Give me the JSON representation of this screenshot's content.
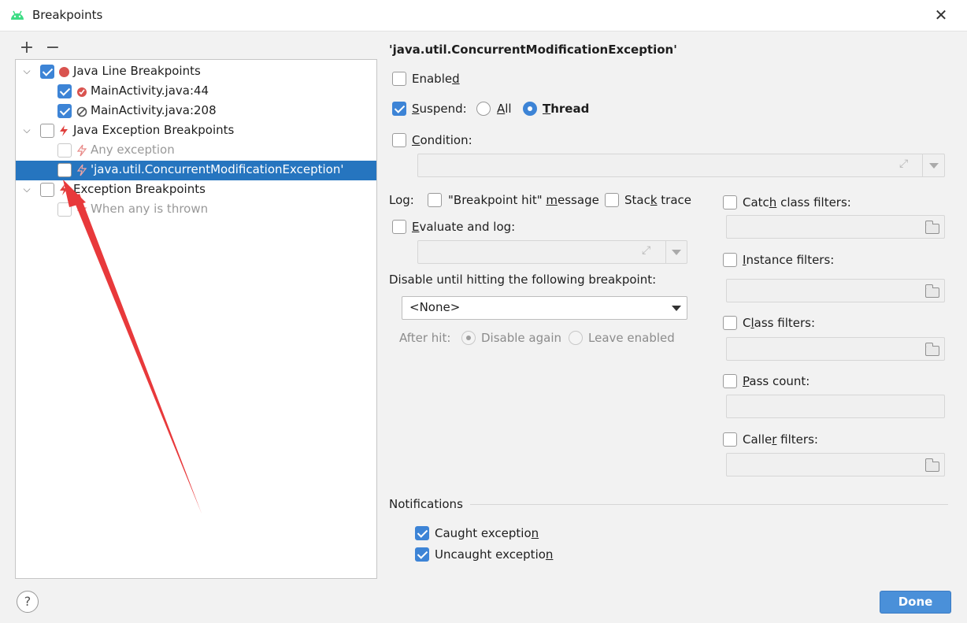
{
  "window": {
    "title": "Breakpoints",
    "close_glyph": "✕",
    "accent": "#3d84d6",
    "selection": "#2675bf",
    "annotation_arrow": "#e8393b"
  },
  "toolbar": {
    "add_glyph": "+",
    "remove_glyph": "−"
  },
  "tree": {
    "java_line": {
      "label": "Java Line Breakpoints",
      "checked": true
    },
    "line_bp_1": {
      "label": "MainActivity.java:44",
      "checked": true
    },
    "line_bp_2": {
      "label": "MainActivity.java:208",
      "checked": true
    },
    "java_exc": {
      "label": "Java Exception Breakpoints",
      "checked": false
    },
    "any_exc": {
      "label": "Any exception",
      "checked": false
    },
    "cme": {
      "label": "'java.util.ConcurrentModificationException'",
      "checked": false,
      "selected": true
    },
    "exc_bp": {
      "label": "Exception Breakpoints",
      "checked": false
    },
    "any_thrown": {
      "label": "When any is thrown",
      "checked": false
    }
  },
  "details": {
    "header": "'java.util.ConcurrentModificationException'",
    "enabled": {
      "pre": "Enable",
      "ul": "d",
      "post": "",
      "checked": false
    },
    "suspend": {
      "pre": "",
      "ul": "S",
      "post": "uspend:",
      "checked": true
    },
    "suspend_all": {
      "pre": "",
      "ul": "A",
      "post": "ll"
    },
    "suspend_thread": {
      "pre": "",
      "ul": "T",
      "post": "hread"
    },
    "condition": {
      "pre": "",
      "ul": "C",
      "post": "ondition:"
    },
    "log_label": "Log:",
    "bp_hit_msg": {
      "pre": "\"Breakpoint hit\" ",
      "ul": "m",
      "post": "essage"
    },
    "stack_trace": {
      "pre": "Stac",
      "ul": "k",
      "post": " trace"
    },
    "evaluate_log": {
      "pre": "",
      "ul": "E",
      "post": "valuate and log:"
    },
    "disable_until_label": "Disable until hitting the following breakpoint:",
    "disable_until_value": "<None>",
    "after_hit_label": "After hit:",
    "disable_again": "Disable again",
    "leave_enabled": "Leave enabled",
    "catch_class_filters": {
      "pre": "Catc",
      "ul": "h",
      "post": " class filters:"
    },
    "instance_filters": {
      "pre": "",
      "ul": "I",
      "post": "nstance filters:"
    },
    "class_filters": {
      "pre": "C",
      "ul": "l",
      "post": "ass filters:"
    },
    "pass_count": {
      "pre": "",
      "ul": "P",
      "post": "ass count:"
    },
    "caller_filters": {
      "pre": "Calle",
      "ul": "r",
      "post": " filters:"
    },
    "notifications_title": "Notifications",
    "caught_exception": {
      "pre": "Caught exceptio",
      "ul": "n",
      "post": "",
      "checked": true
    },
    "uncaught_exception": {
      "pre": "Uncaught exceptio",
      "ul": "n",
      "post": "",
      "checked": true
    }
  },
  "footer": {
    "help_glyph": "?",
    "done_label": "Done"
  }
}
